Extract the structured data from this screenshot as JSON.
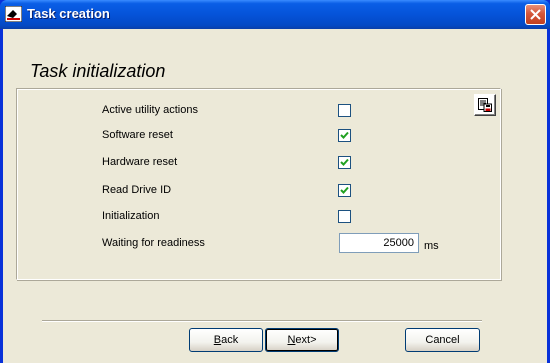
{
  "window": {
    "title": "Task creation"
  },
  "section": {
    "title": "Task initialization"
  },
  "options": [
    {
      "label": "Active utility actions",
      "checked": false
    },
    {
      "label": "Software reset",
      "checked": true
    },
    {
      "label": "Hardware reset",
      "checked": true
    },
    {
      "label": "Read Drive ID",
      "checked": true
    },
    {
      "label": "Initialization",
      "checked": false
    }
  ],
  "waiting": {
    "label": "Waiting for readiness",
    "value": "25000",
    "unit": "ms"
  },
  "buttons": {
    "back_mnemonic": "B",
    "back_rest": "ack",
    "next_mnemonic": "N",
    "next_rest": "ext>",
    "cancel": "Cancel"
  }
}
